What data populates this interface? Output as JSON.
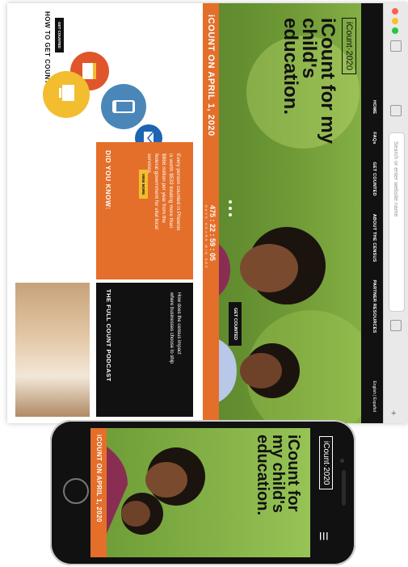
{
  "site": {
    "logo": "iCount·2020",
    "nav": [
      "HOME",
      "FAQs",
      "GET COUNTED",
      "ABOUT THE CENSUS",
      "PARTNER RESOURCES"
    ],
    "languages": "English | Español",
    "headline": "iCount for my child's education.",
    "hero_button": "GET COUNTED",
    "banner": "iCOUNT ON APRIL 1, 2020",
    "countdown": {
      "value": "475 : 22 : 59 : 05",
      "labels": "DAYS HOURS MIN SEC"
    },
    "how": {
      "title": "HOW TO GET COUNTED",
      "button": "GET COUNTED"
    },
    "did_you_know": {
      "title": "DID YOU KNOW:",
      "body": "Every person counted in Phoenix is worth $533 totaling more than $866 million per year from the federal government for vital local services.",
      "button": "VIEW MORE"
    },
    "podcast": {
      "title": "THE FULL COUNT PODCAST",
      "body": "How does the census impact where businesses choose to ship"
    }
  },
  "browser": {
    "address_placeholder": "Search or enter website name"
  },
  "phone": {
    "logo": "iCount·2020",
    "menu_icon": "hamburger-icon",
    "headline": "iCount for my child's education.",
    "banner": "iCOUNT ON APRIL 1, 2020"
  },
  "colors": {
    "orange": "#e46f2a",
    "black": "#111111",
    "yellow": "#f2bd2f",
    "blue": "#4a87b8",
    "green": "#6f9a36"
  }
}
